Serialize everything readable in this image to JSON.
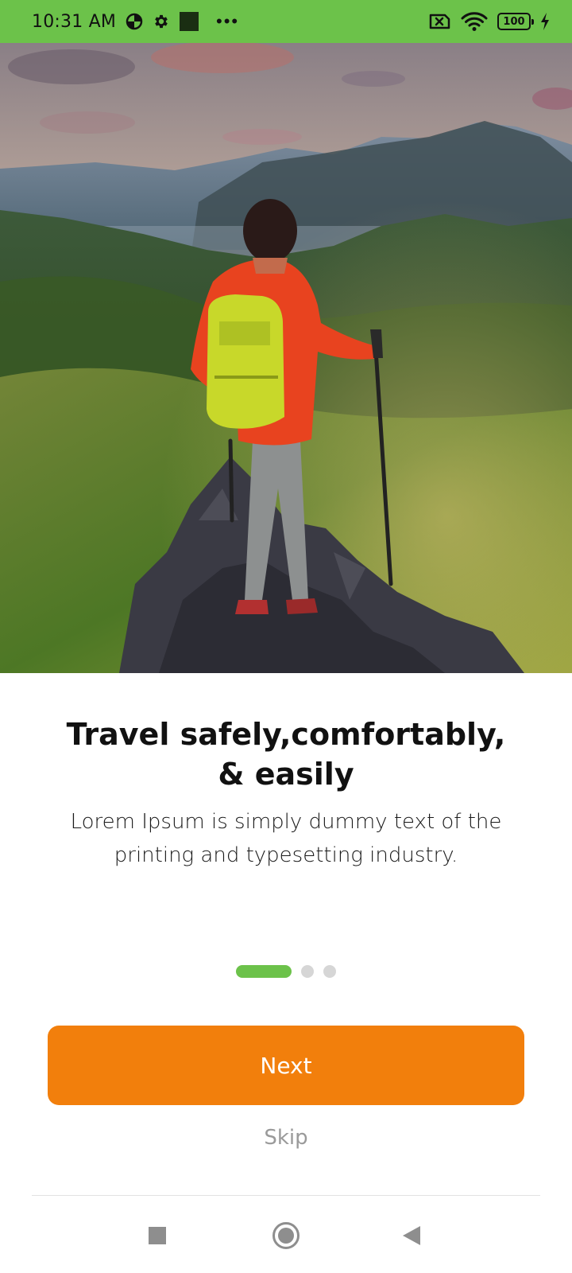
{
  "status_bar": {
    "time": "10:31 AM",
    "battery": "100",
    "icons": [
      "data-saver-icon",
      "settings-gear-icon",
      "notification-square-icon",
      "more-dots-icon",
      "no-sim-icon",
      "wifi-icon",
      "battery-icon",
      "charging-bolt-icon"
    ],
    "background_color": "#6cc24a"
  },
  "hero": {
    "subject": "hiker-on-mountain-photo"
  },
  "onboarding": {
    "title_line1": "Travel safely,comfortably,",
    "title_line2": "& easily",
    "subtitle_line1": "Lorem Ipsum is simply dummy text of the",
    "subtitle_line2": "printing and typesetting industry.",
    "page_indicator": {
      "current": 1,
      "total": 3
    }
  },
  "actions": {
    "next_label": "Next",
    "skip_label": "Skip",
    "accent_color": "#f27f0c",
    "indicator_color": "#6cc24a"
  },
  "nav_bar": {
    "icons": [
      "recents-square-icon",
      "home-circle-icon",
      "back-triangle-icon"
    ]
  }
}
